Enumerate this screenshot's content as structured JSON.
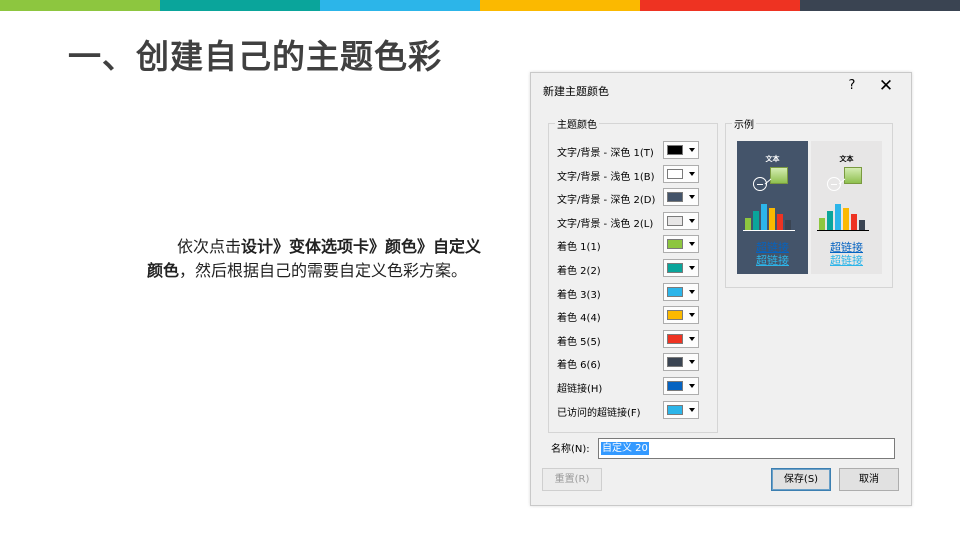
{
  "top_bar_colors": [
    "#8dc63f",
    "#0aa59b",
    "#2cb5e9",
    "#fbb900",
    "#ee3322",
    "#3a4452"
  ],
  "slide": {
    "title": "一、创建自己的主题色彩",
    "body_plain_1": "依次点击",
    "body_bold_1": "设计》变体选项卡》颜色》自定义颜色",
    "body_plain_2": "，然后根据自己的需要自定义色彩方案。"
  },
  "dialog": {
    "title": "新建主题颜色",
    "help_glyph": "?",
    "close_glyph": "✕",
    "theme_colors_group": "主题颜色",
    "sample_group": "示例",
    "color_rows": [
      {
        "label": "文字/背景 - 深色 1(T)",
        "color": "#000000"
      },
      {
        "label": "文字/背景 - 浅色 1(B)",
        "color": "#ffffff"
      },
      {
        "label": "文字/背景 - 深色 2(D)",
        "color": "#44546a"
      },
      {
        "label": "文字/背景 - 浅色 2(L)",
        "color": "#e7e6e6"
      },
      {
        "label": "着色 1(1)",
        "color": "#8dc63f"
      },
      {
        "label": "着色 2(2)",
        "color": "#0aa59b"
      },
      {
        "label": "着色 3(3)",
        "color": "#2cb5e9"
      },
      {
        "label": "着色 4(4)",
        "color": "#fbb900"
      },
      {
        "label": "着色 5(5)",
        "color": "#ee3322"
      },
      {
        "label": "着色 6(6)",
        "color": "#3a4452"
      },
      {
        "label": "超链接(H)",
        "color": "#0563c1"
      },
      {
        "label": "已访问的超链接(F)",
        "color": "#2cb5e9"
      }
    ],
    "sample": {
      "text_label": "文本",
      "link_label": "超链接",
      "visited_link_label": "超链接",
      "dark_bg": "#44546a",
      "light_bg": "#e7e6e6"
    },
    "name_label": "名称(N):",
    "name_value": "自定义 20",
    "reset_button": "重置(R)",
    "save_button": "保存(S)",
    "cancel_button": "取消"
  }
}
